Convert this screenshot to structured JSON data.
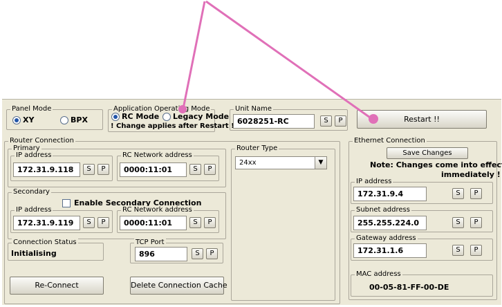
{
  "panel_mode": {
    "legend": "Panel Mode",
    "xy": "XY",
    "bpx": "BPX",
    "selected": "XY"
  },
  "app_mode": {
    "legend": "Application Operating Mode",
    "rc": "RC Mode",
    "legacy": "Legacy Mode",
    "note": "! Change applies after Restart !",
    "selected": "RC Mode"
  },
  "unit_name": {
    "legend": "Unit Name",
    "value": "6028251-RC",
    "s": "S",
    "p": "P"
  },
  "restart": {
    "label": "Restart !!"
  },
  "router": {
    "legend": "Router Connection",
    "primary": {
      "legend": "Primary",
      "ip_legend": "IP address",
      "ip": "172.31.9.118",
      "rc_legend": "RC Network address",
      "rc": "0000:11:01"
    },
    "secondary": {
      "legend": "Secondary",
      "enable": "Enable Secondary Connection",
      "ip_legend": "IP address",
      "ip": "172.31.9.119",
      "rc_legend": "RC Network address",
      "rc": "0000:11:01"
    },
    "type": {
      "legend": "Router Type",
      "value": "24xx"
    },
    "status": {
      "legend": "Connection Status",
      "value": "Initialising"
    },
    "tcp": {
      "legend": "TCP Port",
      "value": "896"
    },
    "reconnect": "Re-Connect",
    "delete_cache": "Delete Connection Cache",
    "s": "S",
    "p": "P"
  },
  "ethernet": {
    "legend": "Ethernet Connection",
    "save": "Save Changes",
    "note1": "Note: Changes come into effect",
    "note2": "immediately !",
    "ip_legend": "IP address",
    "ip": "172.31.9.4",
    "subnet_legend": "Subnet address",
    "subnet": "255.255.224.0",
    "gateway_legend": "Gateway address",
    "gateway": "172.31.1.6",
    "mac_legend": "MAC address",
    "mac": "00-05-81-FF-00-DE",
    "s": "S",
    "p": "P"
  },
  "colors": {
    "annotation": "#e070b8",
    "window_bg": "#ece9d8",
    "radio_dot": "#2255a8"
  }
}
